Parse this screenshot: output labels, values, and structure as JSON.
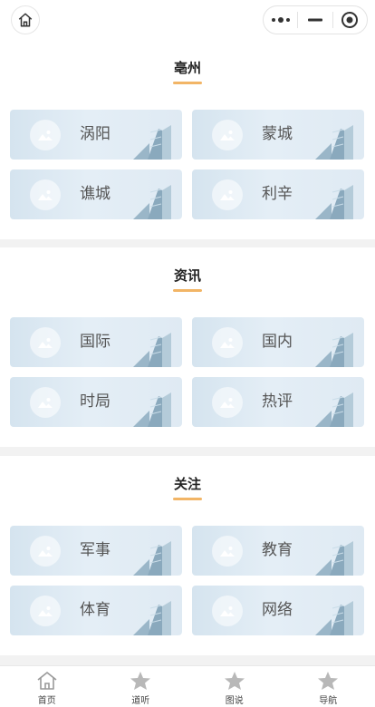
{
  "sections": [
    {
      "title": "亳州",
      "items": [
        "涡阳",
        "蒙城",
        "谯城",
        "利辛"
      ]
    },
    {
      "title": "资讯",
      "items": [
        "国际",
        "国内",
        "时局",
        "热评"
      ]
    },
    {
      "title": "关注",
      "items": [
        "军事",
        "教育",
        "体育",
        "网络"
      ]
    }
  ],
  "tabbar": [
    {
      "label": "首页",
      "icon": "home-icon"
    },
    {
      "label": "道听",
      "icon": "star-icon"
    },
    {
      "label": "图说",
      "icon": "star-icon"
    },
    {
      "label": "导航",
      "icon": "star-icon"
    }
  ],
  "colors": {
    "accent": "#f2b566",
    "card": "#dfeaf3",
    "page_bg": "#f2f2f2"
  }
}
